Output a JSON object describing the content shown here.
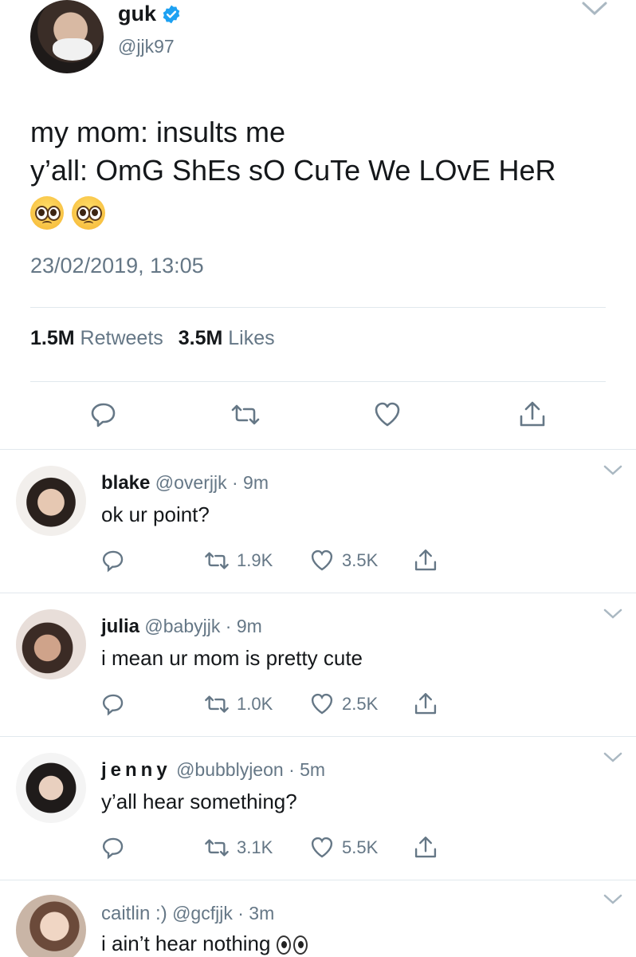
{
  "tweet": {
    "name": "guk",
    "handle": "@jjk97",
    "text_line1": "my mom: insults me",
    "text_line2": "y’all: OmG ShEs sO CuTe We LOvE HeR",
    "emojis": [
      "pleading-face",
      "pleading-face"
    ],
    "timestamp": "23/02/2019, 13:05",
    "retweets_count": "1.5M",
    "retweets_label": "Retweets",
    "likes_count": "3.5M",
    "likes_label": "Likes"
  },
  "replies": [
    {
      "name": "blake",
      "handle": "@overjjk",
      "sep": "·",
      "time": "9m",
      "text": "ok ur point?",
      "retweets": "1.9K",
      "likes": "3.5K",
      "name_style": "bold"
    },
    {
      "name": "julia",
      "handle": "@babyjjk",
      "sep": "·",
      "time": "9m",
      "text": "i mean ur mom is pretty cute",
      "retweets": "1.0K",
      "likes": "2.5K",
      "name_style": "bold"
    },
    {
      "name": "jenny",
      "handle": "@bubblyjeon",
      "sep": "·",
      "time": "5m",
      "text": "y’all hear something?",
      "retweets": "3.1K",
      "likes": "5.5K",
      "name_style": "spaced"
    },
    {
      "name": "caitlin :)",
      "handle": "@gcfjjk",
      "sep": "·",
      "time": "3m",
      "text": "i ain’t hear nothing",
      "name_style": "light"
    }
  ],
  "colors": {
    "text": "#14171a",
    "muted": "#657786",
    "verified": "#1da1f2",
    "divider": "#e1e8ed"
  }
}
